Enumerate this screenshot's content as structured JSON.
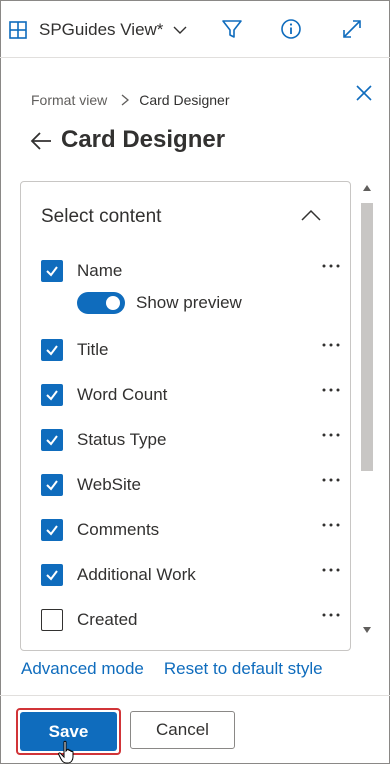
{
  "topbar": {
    "view_label": "SPGuides View*",
    "icons": [
      "grid-view-icon",
      "chevron-down-icon",
      "filter-icon",
      "info-icon",
      "expand-icon"
    ]
  },
  "panel": {
    "breadcrumb": {
      "previous": "Format view",
      "current": "Card Designer"
    },
    "title": "Card Designer",
    "section": {
      "heading": "Select content",
      "items": [
        {
          "label": "Name",
          "checked": true
        },
        {
          "label": "Title",
          "checked": true
        },
        {
          "label": "Word Count",
          "checked": true
        },
        {
          "label": "Status Type",
          "checked": true
        },
        {
          "label": "WebSite",
          "checked": true
        },
        {
          "label": "Comments",
          "checked": true
        },
        {
          "label": "Additional Work",
          "checked": true
        },
        {
          "label": "Created",
          "checked": false
        }
      ],
      "preview_toggle": {
        "label": "Show preview",
        "on": true
      }
    },
    "links": {
      "advanced": "Advanced mode",
      "reset": "Reset to default style"
    }
  },
  "footer": {
    "save_label": "Save",
    "cancel_label": "Cancel"
  },
  "colors": {
    "accent": "#0f6cbd",
    "focus_ring": "#d13438",
    "text": "#323130",
    "border": "#c8c6c4"
  }
}
